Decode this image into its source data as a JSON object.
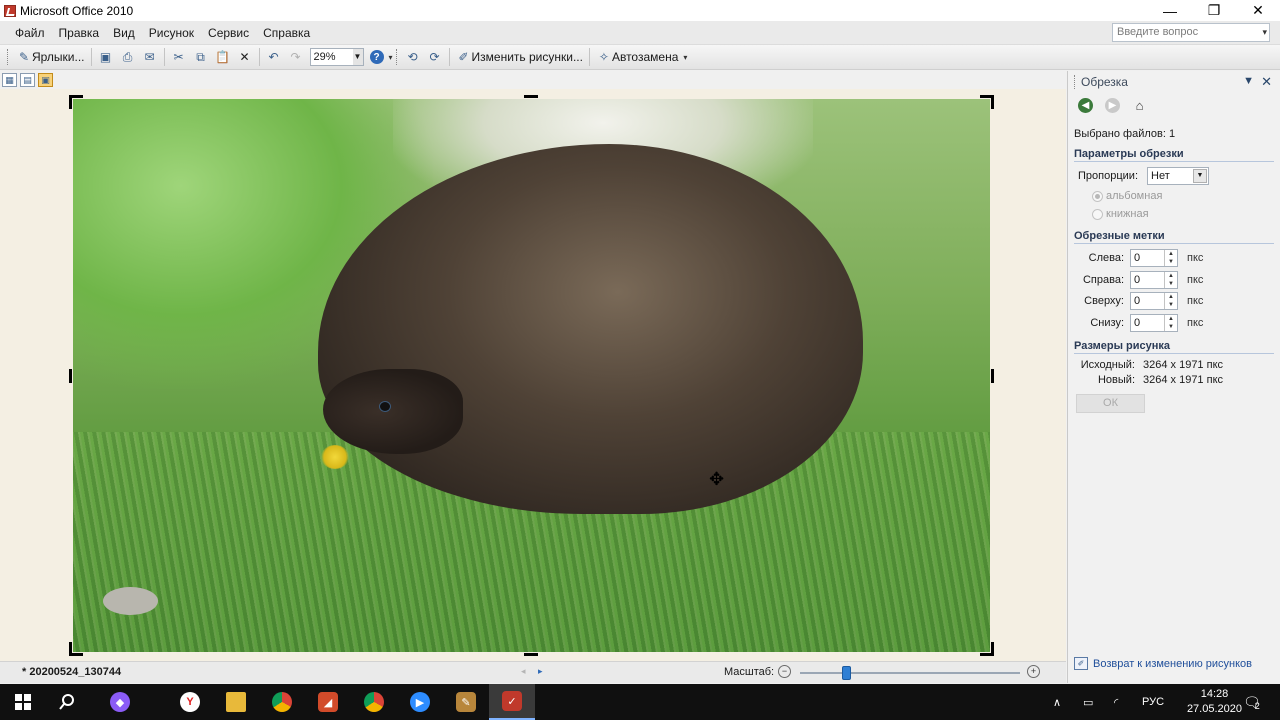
{
  "window": {
    "title": "Microsoft Office 2010",
    "minimize": "—",
    "restore": "❐",
    "close": "✕"
  },
  "menu": {
    "items": [
      "Файл",
      "Правка",
      "Вид",
      "Рисунок",
      "Сервис",
      "Справка"
    ],
    "ask_placeholder": "Введите вопрос"
  },
  "toolbar": {
    "shortcuts_label": "Ярлыки...",
    "zoom_value": "29%",
    "edit_pictures_label": "Изменить рисунки...",
    "autocorrect_label": "Автозамена"
  },
  "pane": {
    "title": "Обрезка",
    "files_selected": "Выбрано файлов: 1",
    "crop_params_header": "Параметры обрезки",
    "aspect_label": "Пропорции:",
    "aspect_value": "Нет",
    "orientation_landscape": "альбомная",
    "orientation_portrait": "книжная",
    "crop_marks_header": "Обрезные метки",
    "crop_marks": [
      {
        "label": "Слева:",
        "value": "0",
        "unit": "пкс"
      },
      {
        "label": "Справа:",
        "value": "0",
        "unit": "пкс"
      },
      {
        "label": "Сверху:",
        "value": "0",
        "unit": "пкс"
      },
      {
        "label": "Снизу:",
        "value": "0",
        "unit": "пкс"
      }
    ],
    "size_header": "Размеры рисунка",
    "original_label": "Исходный:",
    "original_value": "3264 x 1971 пкс",
    "new_label": "Новый:",
    "new_value": "3264 x 1971 пкс",
    "ok_label": "ОК",
    "return_link": "Возврат к изменению рисунков"
  },
  "status": {
    "file_name": "* 20200524_130744",
    "zoom_label": "Масштаб:",
    "zoom_level": 0.21
  },
  "taskbar": {
    "language": "РУС",
    "time": "14:28",
    "date": "27.05.2020",
    "notifications": "2"
  }
}
